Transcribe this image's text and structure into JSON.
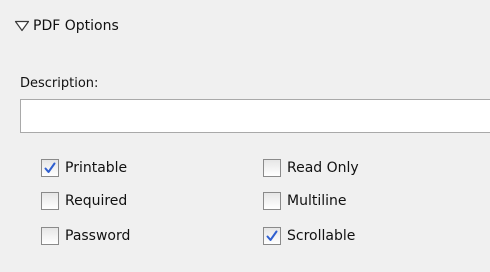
{
  "section": {
    "title": "PDF Options",
    "expanded": true,
    "icon": "triangle-down-icon"
  },
  "description": {
    "label": "Description:",
    "value": ""
  },
  "options": {
    "printable": {
      "label": "Printable",
      "checked": true
    },
    "read_only": {
      "label": "Read Only",
      "checked": false
    },
    "required": {
      "label": "Required",
      "checked": false
    },
    "multiline": {
      "label": "Multiline",
      "checked": false
    },
    "password": {
      "label": "Password",
      "checked": false
    },
    "scrollable": {
      "label": "Scrollable",
      "checked": true
    }
  },
  "colors": {
    "checkmark": "#2f5fd0",
    "panel_background": "#f0f0f0"
  }
}
